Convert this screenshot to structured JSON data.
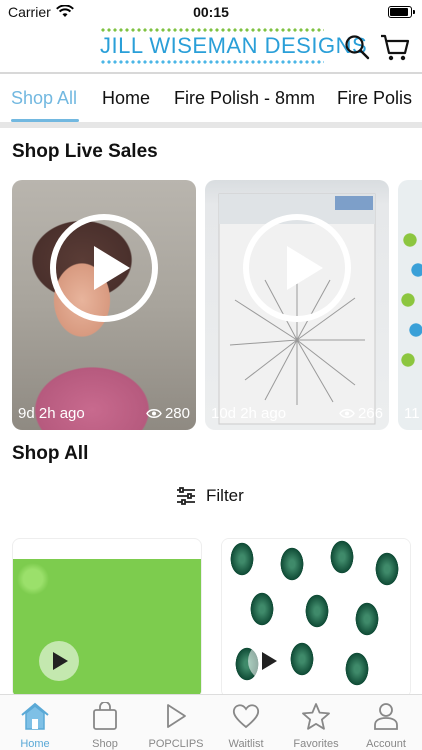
{
  "status_bar": {
    "carrier": "Carrier",
    "time": "00:15"
  },
  "header": {
    "logo_text": "JILL WISEMAN DESIGNS",
    "icons": [
      "search-icon",
      "cart-icon"
    ]
  },
  "tabs": [
    {
      "label": "Shop All",
      "active": true
    },
    {
      "label": "Home",
      "active": false
    },
    {
      "label": "Fire Polish - 8mm",
      "active": false
    },
    {
      "label": "Fire Polis",
      "active": false
    }
  ],
  "live_sales": {
    "title": "Shop Live Sales",
    "items": [
      {
        "ago": "9d 2h ago",
        "views": "280"
      },
      {
        "ago": "10d 2h ago",
        "views": "266"
      },
      {
        "ago": "11",
        "views": ""
      }
    ]
  },
  "shop_all": {
    "title": "Shop All",
    "filter_label": "Filter"
  },
  "tab_bar": [
    {
      "label": "Home",
      "icon": "home-icon",
      "active": true
    },
    {
      "label": "Shop",
      "icon": "bag-icon",
      "active": false
    },
    {
      "label": "POPCLIPS",
      "icon": "play-icon",
      "active": false
    },
    {
      "label": "Waitlist",
      "icon": "heart-icon",
      "active": false
    },
    {
      "label": "Favorites",
      "icon": "star-icon",
      "active": false
    },
    {
      "label": "Account",
      "icon": "person-icon",
      "active": false
    }
  ],
  "colors": {
    "accent": "#72b8e0",
    "logo_blue": "#2a9fd8",
    "logo_green": "#7fc242"
  }
}
